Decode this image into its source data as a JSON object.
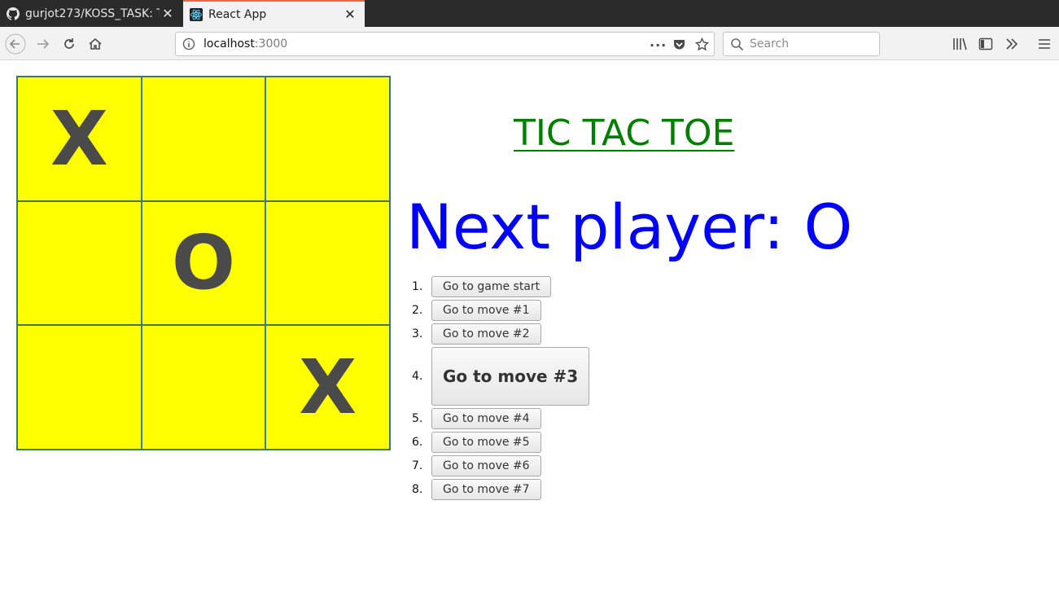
{
  "browser": {
    "tabs": [
      {
        "title": "gurjot273/KOSS_TASK: T",
        "favicon": "github-icon",
        "active": false
      },
      {
        "title": "React App",
        "favicon": "react-icon",
        "active": true
      }
    ],
    "url_host": "localhost",
    "url_port": ":3000",
    "search_placeholder": "Search"
  },
  "game": {
    "title": "TIC TAC TOE",
    "status": "Next player: O",
    "squares": [
      "X",
      "",
      "",
      "",
      "O",
      "",
      "",
      "",
      "X"
    ],
    "moves": [
      {
        "num": "1.",
        "label": "Go to game start"
      },
      {
        "num": "2.",
        "label": "Go to move #1"
      },
      {
        "num": "3.",
        "label": "Go to move #2"
      },
      {
        "num": "4.",
        "label": "Go to move #3",
        "current": true
      },
      {
        "num": "5.",
        "label": "Go to move #4"
      },
      {
        "num": "6.",
        "label": "Go to move #5"
      },
      {
        "num": "7.",
        "label": "Go to move #6"
      },
      {
        "num": "8.",
        "label": "Go to move #7"
      }
    ]
  },
  "colors": {
    "square_bg": "#ffff00",
    "title": "#008000",
    "status": "#0000ff",
    "mark": "#4a4a4a"
  }
}
